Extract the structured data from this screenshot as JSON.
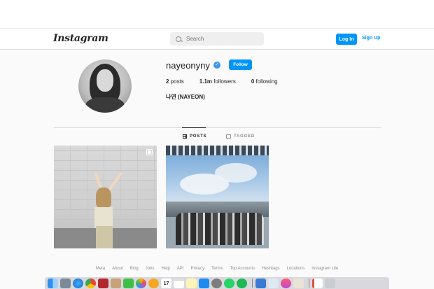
{
  "header": {
    "logo": "Instagram",
    "search_placeholder": "Search",
    "login_label": "Log In",
    "signup_label": "Sign Up"
  },
  "profile": {
    "username": "nayeonyny",
    "verified_mark": "✓",
    "follow_label": "Follow",
    "posts_count": "2",
    "posts_label": " posts",
    "followers_count": "1.1m",
    "followers_label": " followers",
    "following_count": "0",
    "following_label": " following",
    "full_name": "나연 (NAYEON)"
  },
  "tabs": {
    "posts": "POSTS",
    "tagged": "TAGGED"
  },
  "footer": {
    "links": [
      "Meta",
      "About",
      "Blog",
      "Jobs",
      "Help",
      "API",
      "Privacy",
      "Terms",
      "Top Accounts",
      "Hashtags",
      "Locations",
      "Instagram Lite"
    ]
  },
  "colors": {
    "accent": "#0095f6",
    "verified": "#3897f0",
    "text": "#262626",
    "muted": "#8e8e8e",
    "background": "#fafafa"
  },
  "dock": {
    "icons": [
      "finder-icon",
      "launchpad-icon",
      "safari-icon",
      "chrome-icon",
      "photobooth-icon",
      "contacts-icon",
      "facetime-icon",
      "photos-icon",
      "clock-icon",
      "calendar-icon",
      "notes-icon",
      "reminders-icon",
      "appstore-icon",
      "settings-icon",
      "whatsapp-icon",
      "spotify-icon",
      "keynote-icon",
      "preview-icon",
      "itunes-icon",
      "script-icon",
      "pages-icon",
      "trash-icon"
    ],
    "calendar_day": "17"
  }
}
